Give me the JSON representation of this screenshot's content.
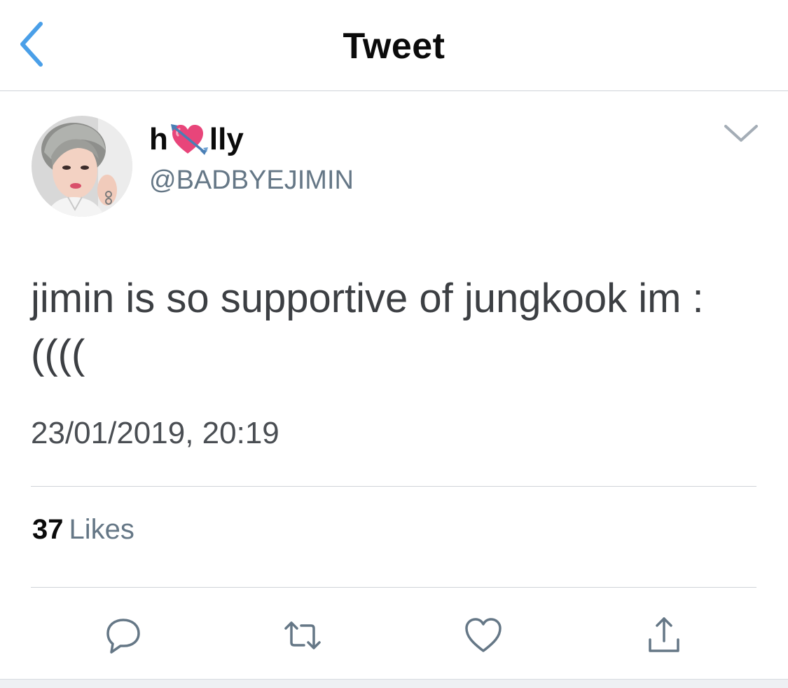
{
  "nav": {
    "title": "Tweet",
    "back_icon": "chevron-left-icon"
  },
  "colors": {
    "accent": "#4a9fe8",
    "secondary_text": "#657786",
    "divider": "#cfd3d8",
    "heart_emoji": "#e8457a"
  },
  "author": {
    "name_prefix": "h",
    "name_emoji": "heart-with-arrow-emoji",
    "name_suffix": "lly",
    "handle": "@BADBYEJIMIN"
  },
  "tweet": {
    "text": "jimin is so supportive of jungkook im : ((((",
    "timestamp": "23/01/2019, 20:19"
  },
  "stats": {
    "likes_count": "37",
    "likes_label": "Likes"
  },
  "actions": [
    {
      "name": "reply",
      "icon": "comment-icon"
    },
    {
      "name": "retweet",
      "icon": "retweet-icon"
    },
    {
      "name": "like",
      "icon": "heart-icon"
    },
    {
      "name": "share",
      "icon": "share-icon"
    }
  ]
}
